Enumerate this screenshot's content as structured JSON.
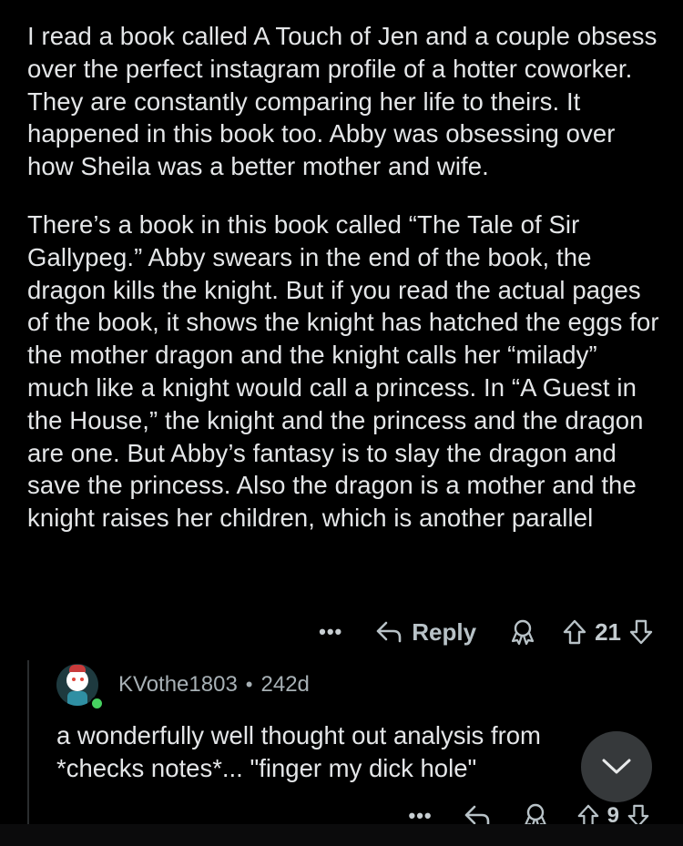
{
  "post": {
    "paragraphs": [
      "I read a book called A Touch of Jen and a couple obsess over the perfect instagram profile of a hotter coworker. They are constantly comparing her life to theirs. It happened in this book too. Abby was obsessing over how Sheila was a better mother and wife.",
      "There’s a book in this book called “The Tale of Sir Gallypeg.” Abby swears in the end of the book, the dragon kills the knight. But if you read the actual pages of the book, it shows the knight has hatched the eggs for the mother dragon and the knight calls her “milady” much like a knight would call a princess. In “A Guest in the House,” the knight and the princess and the dragon are one. But Abby’s fantasy is to slay the dragon and save the princess. Also the dragon is a mother and the knight raises her children, which is another parallel"
    ],
    "actions": {
      "more": "•••",
      "reply_label": "Reply",
      "score": "21"
    }
  },
  "reply_comment": {
    "username": "KVothe1803",
    "separator": "•",
    "age": "242d",
    "text_line1": "a wonderfully well thought out analysis from",
    "text_line2": "*checks notes*... \"finger my dick hole\"",
    "actions": {
      "more": "•••",
      "score": "9"
    }
  },
  "icons": {
    "reply": "reply-arrow-icon",
    "award": "award-icon",
    "upvote": "upvote-arrow-icon",
    "downvote": "downvote-arrow-icon",
    "scroll_down": "chevron-down-icon"
  },
  "colors": {
    "background": "#000000",
    "text": "#e4e6e8",
    "meta": "#a7b0b5",
    "online": "#46d160"
  }
}
